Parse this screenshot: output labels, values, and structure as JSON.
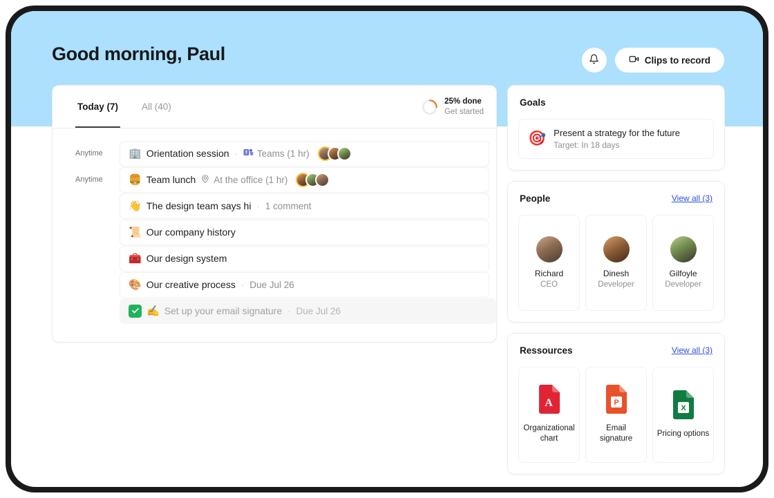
{
  "header": {
    "greeting": "Good morning, Paul",
    "notifications_icon": "bell-icon",
    "clips_button": "Clips to record",
    "clips_icon": "video-camera-icon"
  },
  "tasks_panel": {
    "tabs": [
      {
        "label": "Today (7)",
        "active": true
      },
      {
        "label": "All (40)",
        "active": false
      }
    ],
    "progress": {
      "percent": 25,
      "title": "25% done",
      "subtitle": "Get started",
      "color": "#f07a1a",
      "track_color": "#e8e9eb"
    },
    "rows": [
      {
        "time": "Anytime",
        "emoji": "🏢",
        "title": "Orientation session",
        "separator": "·",
        "meta_icon": "teams-icon",
        "meta": "Teams (1 hr)",
        "avatars": 3,
        "done": false
      },
      {
        "time": "Anytime",
        "emoji": "🍔",
        "title": "Team lunch",
        "separator": "",
        "meta_icon": "location-pin-icon",
        "meta": "At the office (1 hr)",
        "avatars": 3,
        "done": false
      },
      {
        "time": "",
        "emoji": "👋",
        "title": "The design team says hi",
        "separator": "·",
        "meta_icon": "",
        "meta": "1 comment",
        "avatars": 0,
        "done": false
      },
      {
        "time": "",
        "emoji": "📜",
        "title": "Our company history",
        "separator": "",
        "meta_icon": "",
        "meta": "",
        "avatars": 0,
        "done": false
      },
      {
        "time": "",
        "emoji": "🧰",
        "title": "Our design system",
        "separator": "",
        "meta_icon": "",
        "meta": "",
        "avatars": 0,
        "done": false
      },
      {
        "time": "",
        "emoji": "🎨",
        "title": "Our creative process",
        "separator": "·",
        "meta_icon": "",
        "meta": "Due Jul 26",
        "avatars": 0,
        "done": false
      },
      {
        "time": "",
        "emoji": "✍️",
        "title": "Set up your email signature",
        "separator": "·",
        "meta_icon": "",
        "meta": "Due Jul 26",
        "avatars": 0,
        "done": true
      }
    ]
  },
  "goals": {
    "title": "Goals",
    "items": [
      {
        "emoji": "🎯",
        "name": "Present a strategy for the future",
        "target": "Target: In 18 days"
      }
    ]
  },
  "people": {
    "title": "People",
    "view_all": "View all (3)",
    "items": [
      {
        "name": "Richard",
        "role": "CEO"
      },
      {
        "name": "Dinesh",
        "role": "Developer"
      },
      {
        "name": "Gilfoyle",
        "role": "Developer"
      }
    ]
  },
  "resources": {
    "title": "Ressources",
    "view_all": "View all (3)",
    "items": [
      {
        "label": "Organizational chart",
        "icon": "pdf-file-icon",
        "color": "#e02434"
      },
      {
        "label": "Email signature",
        "icon": "powerpoint-file-icon",
        "color": "#e8522a"
      },
      {
        "label": "Pricing options",
        "icon": "excel-file-icon",
        "color": "#107c41"
      }
    ]
  }
}
